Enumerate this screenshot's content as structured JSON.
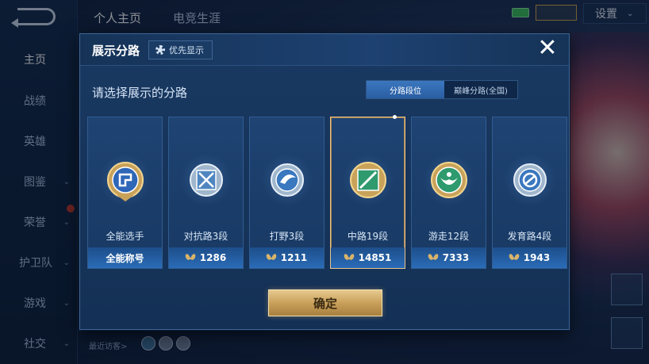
{
  "sidebar": {
    "items": [
      {
        "label": "主页",
        "active": true,
        "chevron": false
      },
      {
        "label": "战绩",
        "active": false,
        "chevron": false
      },
      {
        "label": "英雄",
        "active": false,
        "chevron": false
      },
      {
        "label": "图鉴",
        "active": false,
        "chevron": true
      },
      {
        "label": "荣誉",
        "active": false,
        "chevron": true
      },
      {
        "label": "护卫队",
        "active": false,
        "chevron": true
      },
      {
        "label": "游戏",
        "active": false,
        "chevron": true
      },
      {
        "label": "社交",
        "active": false,
        "chevron": true
      }
    ]
  },
  "top_tabs": [
    {
      "label": "个人主页",
      "active": true
    },
    {
      "label": "电竞生涯",
      "active": false
    }
  ],
  "header_right": {
    "settings_label": "设置"
  },
  "bottom": {
    "visitor_label": "最近访客>"
  },
  "modal": {
    "title": "展示分路",
    "priority_label": "优先显示",
    "close_symbol": "✕",
    "subtitle": "请选择展示的分路",
    "toggle": {
      "option_a": "分路段位",
      "option_b": "巅峰分路(全国)",
      "selected": "option_a"
    },
    "cards": [
      {
        "name": "全能选手",
        "footer": "全能称号",
        "footer_icon": false,
        "selected": false,
        "emblem_color": "#c9a25a",
        "inner_color": "#2e66b8"
      },
      {
        "name": "对抗路3段",
        "footer": "1286",
        "footer_icon": true,
        "selected": false,
        "emblem_color": "#9fb6cc",
        "inner_color": "#4f86c0"
      },
      {
        "name": "打野3段",
        "footer": "1211",
        "footer_icon": true,
        "selected": false,
        "emblem_color": "#9fb6cc",
        "inner_color": "#3a78bf"
      },
      {
        "name": "中路19段",
        "footer": "14851",
        "footer_icon": true,
        "selected": true,
        "emblem_color": "#c9a25a",
        "inner_color": "#2e9a6e"
      },
      {
        "name": "游走12段",
        "footer": "7333",
        "footer_icon": true,
        "selected": false,
        "emblem_color": "#c9a25a",
        "inner_color": "#2e9a6e"
      },
      {
        "name": "发育路4段",
        "footer": "1943",
        "footer_icon": true,
        "selected": false,
        "emblem_color": "#9fb6cc",
        "inner_color": "#3a78bf"
      }
    ],
    "confirm_label": "确定"
  },
  "colors": {
    "modal_bg": "#17355c",
    "accent_blue": "#2b5ea2",
    "gold": "#c9a05a",
    "selected_border": "#e9c48a"
  }
}
